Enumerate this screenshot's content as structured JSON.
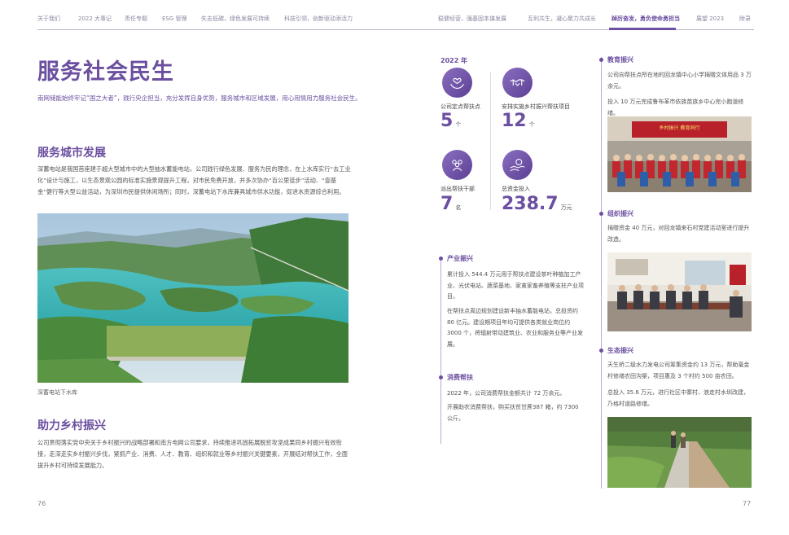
{
  "nav": {
    "items": [
      "关于我们",
      "2022 大事记",
      "责任专题",
      "ESG 管理",
      "失志低碳，绿色发展可持续",
      "科技引领，创新驱动添活力",
      "稳健经营，强基固本谋发展",
      "互利共生，凝心聚力共成长",
      "踔厉奋发，勇负使命勇担当",
      "展望 2023",
      "附录"
    ],
    "active_index": 8
  },
  "page": {
    "title": "服务社会民生",
    "intro": "南网储能始终牢记“国之大者”，践行央企担当，充分发挥自身优势，服务城市和区域发展，用心用情用力服务社会民生。",
    "section1": {
      "heading": "服务城市发展",
      "text": "深蓄电站是我国首座建于超大型城市中的大型抽水蓄能电站，公司践行绿色发展、服务为民的理念，在上水库实行“去工业化”设计与施工，以生态景观公园的标准实施景观提升工程，对市民免费开放，并多次协办“百公里徒步”活动、“壹基金”健行等大型公益活动，为深圳市民提供休闲场所；同时，深蓄电站下水库兼具城市供水功能，促进水资源综合利用。",
      "caption": "深蓄电站下水库"
    },
    "section2": {
      "heading": "助力乡村振兴",
      "text": "公司贯彻落实党中央关于乡村振兴的战略部署和南方电网公司要求，持续推进巩固拓展脱贫攻坚成果同乡村振兴有效衔接，走深走实乡村振兴步伐，紧抓产业、消费、人才、教育、组织和就业等乡村振兴关键要素，开展结对帮扶工作，全面提升乡村可持续发展能力。"
    },
    "page_left": "76",
    "page_right": "77"
  },
  "stats": {
    "year": "2022 年",
    "items": [
      {
        "label": "公司定点帮扶点",
        "value": "5",
        "unit": "个",
        "icon": "heart-hands-icon"
      },
      {
        "label": "安排实施乡村振兴帮扶项目",
        "value": "12",
        "unit": "个",
        "icon": "handshake-icon"
      },
      {
        "label": "派出帮扶干部",
        "value": "7",
        "unit": "名",
        "icon": "people-icon"
      },
      {
        "label": "总资金投入",
        "value": "238.7",
        "unit": "万元",
        "icon": "money-hand-icon"
      }
    ]
  },
  "mid_sections": [
    {
      "heading": "产业振兴",
      "paras": [
        "累计投入 544.4 万元用于帮扶点建设茶叶种植加工产业、光伏电站、蔬菜基地、家禽家畜养殖等支柱产业项目。",
        "在帮扶点周边规划建设新丰抽水蓄能电站，总投资约 80 亿元。建设期项目年均可提供各类就业岗位约 3000 个，将辐射带动建筑业、农业和服务业等产业发展。"
      ]
    },
    {
      "heading": "消费帮扶",
      "paras": [
        "2022 年，公司消费帮扶金额共计 72 万余元。",
        "开展助农消费帮扶，购买扶贫甘蔗387 箱，约 7300 公斤。"
      ]
    }
  ],
  "right_sections": [
    {
      "heading": "教育振兴",
      "paras": [
        "公司向帮扶点所在地的回龙镇中心小学捐赠文体用品 3 万余元。",
        "投入 10 万元完成鲁布革市依族苗族乡中心完小跑道修缮。"
      ],
      "banner": "乡村振兴 教育同行"
    },
    {
      "heading": "组织振兴",
      "paras": [
        "捐赠资金 40 万元，对回龙镇来石村党建活动室进行提升改造。"
      ]
    },
    {
      "heading": "生态振兴",
      "paras": [
        "天生桥二级水力发电公司筹集资金约 13 万元，帮助毫金村修缮农田沟渠，项目惠及 3 个村约 500 亩农田。",
        "总投入 35.6 万元，进行社区中寨村、浪走村水圳改建，乃格村道路修缮。"
      ]
    }
  ],
  "colors": {
    "accent": "#6b4fa0",
    "line": "#b9a9d8"
  }
}
